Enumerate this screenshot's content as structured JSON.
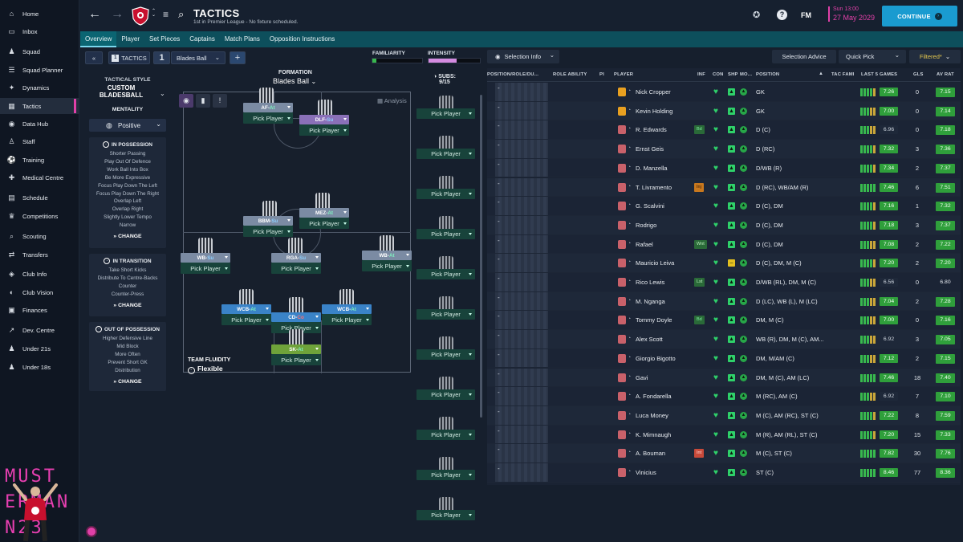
{
  "sidebar": {
    "items": [
      {
        "label": "Home",
        "icon": "home-icon",
        "glyph": "⌂"
      },
      {
        "label": "Inbox",
        "icon": "inbox-icon",
        "glyph": "▭"
      },
      {
        "label": "Squad",
        "icon": "squad-icon",
        "glyph": "♟"
      },
      {
        "label": "Squad Planner",
        "icon": "squad-planner-icon",
        "glyph": "☰"
      },
      {
        "label": "Dynamics",
        "icon": "dynamics-icon",
        "glyph": "✦"
      },
      {
        "label": "Tactics",
        "icon": "tactics-icon",
        "glyph": "▦"
      },
      {
        "label": "Data Hub",
        "icon": "data-hub-icon",
        "glyph": "◉"
      },
      {
        "label": "Staff",
        "icon": "staff-icon",
        "glyph": "♙"
      },
      {
        "label": "Training",
        "icon": "training-icon",
        "glyph": "⚽"
      },
      {
        "label": "Medical Centre",
        "icon": "medical-centre-icon",
        "glyph": "✚"
      },
      {
        "label": "Schedule",
        "icon": "schedule-icon",
        "glyph": "▤"
      },
      {
        "label": "Competitions",
        "icon": "competitions-icon",
        "glyph": "♛"
      },
      {
        "label": "Scouting",
        "icon": "scouting-icon",
        "glyph": "⌕"
      },
      {
        "label": "Transfers",
        "icon": "transfers-icon",
        "glyph": "⇄"
      },
      {
        "label": "Club Info",
        "icon": "club-info-icon",
        "glyph": "◈"
      },
      {
        "label": "Club Vision",
        "icon": "club-vision-icon",
        "glyph": "◐"
      },
      {
        "label": "Finances",
        "icon": "finances-icon",
        "glyph": "▣"
      },
      {
        "label": "Dev. Centre",
        "icon": "dev-centre-icon",
        "glyph": "↗"
      },
      {
        "label": "Under 21s",
        "icon": "under-21s-icon",
        "glyph": "♟"
      },
      {
        "label": "Under 18s",
        "icon": "under-18s-icon",
        "glyph": "♟"
      }
    ],
    "promo_text": "MUST ERMAN N23",
    "brand_color": "#e040a8"
  },
  "topbar": {
    "title": "TACTICS",
    "subtitle": "1st in Premier League - No fixture scheduled.",
    "menu_icon": "≡",
    "search_icon": "⌕",
    "date_time": "Sun 13:00",
    "date": "27 May 2029",
    "fm_label": "FM",
    "continue_label": "CONTINUE",
    "continue_color": "#1a9bd0"
  },
  "tabs": [
    "Overview",
    "Player",
    "Set Pieces",
    "Captains",
    "Match Plans",
    "Opposition Instructions"
  ],
  "tactics_bar": {
    "label": "TACTICS",
    "slot": "1",
    "tactic_name": "Blades Ball",
    "add": "+",
    "collapse": "«"
  },
  "meters": {
    "familiarity_label": "FAMILIARITY",
    "intensity_label": "INTENSITY",
    "familiarity_value": 0.08,
    "intensity_value": 0.55
  },
  "tactic_panel": {
    "style_label": "TACTICAL STYLE",
    "style_name": "CUSTOM BLADESBALL",
    "mentality_label": "MENTALITY",
    "mentality_value": "Positive",
    "in_possession_title": "IN POSSESSION",
    "in_possession": [
      "Shorter Passing",
      "Play Out Of Defence",
      "Work Ball Into Box",
      "Be More Expressive",
      "Focus Play Down The Left",
      "Focus Play Down The Right",
      "Overlap Left",
      "Overlap Right",
      "Slightly Lower Tempo",
      "Narrow"
    ],
    "in_transition_title": "IN TRANSITION",
    "in_transition": [
      "Take Short Kicks",
      "Distribute To Centre-Backs",
      "Counter",
      "Counter-Press"
    ],
    "out_of_possession_title": "OUT OF POSSESSION",
    "out_of_possession": [
      "Higher Defensive Line",
      "Mid Block",
      "More Often",
      "Prevent Short GK",
      "Distribution"
    ],
    "change_label": "CHANGE"
  },
  "pitch": {
    "formation_label": "FORMATION",
    "formation_value": "Blades Ball",
    "analysis_label": "Analysis",
    "fluidity_label": "TEAM FLUIDITY",
    "fluidity_value": "Flexible",
    "pick_label": "Pick Player",
    "positions": [
      {
        "role": "AF",
        "duty": "At",
        "color": "#7b8ba3"
      },
      {
        "role": "DLF",
        "duty": "Su",
        "color": "#8a70b8"
      },
      {
        "role": "BBM",
        "duty": "Su",
        "color": "#7b8ba3"
      },
      {
        "role": "MEZ",
        "duty": "At",
        "color": "#7b8ba3"
      },
      {
        "role": "WB",
        "duty": "Su",
        "color": "#7b8ba3"
      },
      {
        "role": "RGA",
        "duty": "Su",
        "color": "#7b8ba3"
      },
      {
        "role": "WB",
        "duty": "At",
        "color": "#7b8ba3"
      },
      {
        "role": "WCB",
        "duty": "At",
        "color": "#3a83c8"
      },
      {
        "role": "CD",
        "duty": "Co",
        "color": "#3a83c8"
      },
      {
        "role": "WCB",
        "duty": "At",
        "color": "#3a83c8"
      },
      {
        "role": "SK",
        "duty": "At",
        "color": "#6fa33a"
      }
    ]
  },
  "subs": {
    "label": "SUBS:",
    "count": "9/15",
    "pick_label": "Pick Player",
    "slots": 11
  },
  "right_tools": {
    "selection_info": "Selection Info",
    "selection_advice": "Selection Advice",
    "quick_pick": "Quick Pick",
    "filtered": "Filtered*"
  },
  "table": {
    "headers": [
      "POSITION/ROLE/DU...",
      "ROLE ABILITY",
      "PI",
      "PLAYER",
      "INF",
      "CON",
      "SHP",
      "MO...",
      "POSITION",
      "TAC FAMI",
      "LAST 5 GAMES",
      "GLS",
      "AV RAT"
    ],
    "rows": [
      {
        "player": "Nick Cropper",
        "pos": "GK",
        "rating": "7.26",
        "gls": "0",
        "avrat": "7.15",
        "inf": "",
        "shirt": "gk",
        "shp": "up"
      },
      {
        "player": "Kevin Holding",
        "pos": "GK",
        "rating": "7.00",
        "gls": "0",
        "avrat": "7.14",
        "inf": "",
        "shirt": "gk",
        "shp": "up"
      },
      {
        "player": "R. Edwards",
        "pos": "D (C)",
        "rating": "6.96",
        "gls": "0",
        "avrat": "7.18",
        "inf": "Bd",
        "shirt": "out",
        "shp": "up"
      },
      {
        "player": "Ernst Geis",
        "pos": "D (RC)",
        "rating": "7.32",
        "gls": "3",
        "avrat": "7.36",
        "inf": "",
        "shirt": "out",
        "shp": "up"
      },
      {
        "player": "D. Manzella",
        "pos": "D/WB (R)",
        "rating": "7.34",
        "gls": "2",
        "avrat": "7.37",
        "inf": "",
        "shirt": "out",
        "shp": "up"
      },
      {
        "player": "T. Livramento",
        "pos": "D (RC), WB/AM (R)",
        "rating": "7.46",
        "gls": "6",
        "avrat": "7.51",
        "inf": "Inj",
        "shirt": "out",
        "shp": "up"
      },
      {
        "player": "G. Scalvini",
        "pos": "D (C), DM",
        "rating": "7.16",
        "gls": "1",
        "avrat": "7.32",
        "inf": "",
        "shirt": "out",
        "shp": "up"
      },
      {
        "player": "Rodrigo",
        "pos": "D (C), DM",
        "rating": "7.18",
        "gls": "3",
        "avrat": "7.37",
        "inf": "",
        "shirt": "out",
        "shp": "up"
      },
      {
        "player": "Rafael",
        "pos": "D (C), DM",
        "rating": "7.08",
        "gls": "2",
        "avrat": "7.22",
        "inf": "Wnt",
        "shirt": "out",
        "shp": "up"
      },
      {
        "player": "Mauricio Leiva",
        "pos": "D (C), DM, M (C)",
        "rating": "7.20",
        "gls": "2",
        "avrat": "7.20",
        "inf": "",
        "shirt": "out",
        "shp": "mid"
      },
      {
        "player": "Rico Lewis",
        "pos": "D/WB (RL), DM, M (C)",
        "rating": "6.56",
        "gls": "0",
        "avrat": "6.80",
        "inf": "Lst",
        "shirt": "out",
        "shp": "up"
      },
      {
        "player": "M. Nganga",
        "pos": "D (LC), WB (L), M (LC)",
        "rating": "7.04",
        "gls": "2",
        "avrat": "7.28",
        "inf": "",
        "shirt": "out",
        "shp": "up"
      },
      {
        "player": "Tommy Doyle",
        "pos": "DM, M (C)",
        "rating": "7.00",
        "gls": "0",
        "avrat": "7.16",
        "inf": "Bd",
        "shirt": "out",
        "shp": "up"
      },
      {
        "player": "Alex Scott",
        "pos": "WB (R), DM, M (C), AM...",
        "rating": "6.92",
        "gls": "3",
        "avrat": "7.05",
        "inf": "",
        "shirt": "out",
        "shp": "up"
      },
      {
        "player": "Giorgio Bigotto",
        "pos": "DM, M/AM (C)",
        "rating": "7.12",
        "gls": "2",
        "avrat": "7.15",
        "inf": "",
        "shirt": "out",
        "shp": "up"
      },
      {
        "player": "Gavi",
        "pos": "DM, M (C), AM (LC)",
        "rating": "7.46",
        "gls": "18",
        "avrat": "7.40",
        "inf": "",
        "shirt": "out",
        "shp": "up"
      },
      {
        "player": "A. Fondarella",
        "pos": "M (RC), AM (C)",
        "rating": "6.92",
        "gls": "7",
        "avrat": "7.10",
        "inf": "",
        "shirt": "out",
        "shp": "up"
      },
      {
        "player": "Luca Money",
        "pos": "M (C), AM (RC), ST (C)",
        "rating": "7.22",
        "gls": "8",
        "avrat": "7.59",
        "inf": "",
        "shirt": "out",
        "shp": "up"
      },
      {
        "player": "K. Mimnaugh",
        "pos": "M (R), AM (RL), ST (C)",
        "rating": "7.20",
        "gls": "15",
        "avrat": "7.33",
        "inf": "",
        "shirt": "out",
        "shp": "up"
      },
      {
        "player": "A. Bouman",
        "pos": "M (C), ST (C)",
        "rating": "7.82",
        "gls": "30",
        "avrat": "7.76",
        "inf": "Int",
        "shirt": "out",
        "shp": "up"
      },
      {
        "player": "Vinicius",
        "pos": "ST (C)",
        "rating": "8.46",
        "gls": "77",
        "avrat": "8.36",
        "inf": "",
        "shirt": "out",
        "shp": "up"
      }
    ]
  }
}
